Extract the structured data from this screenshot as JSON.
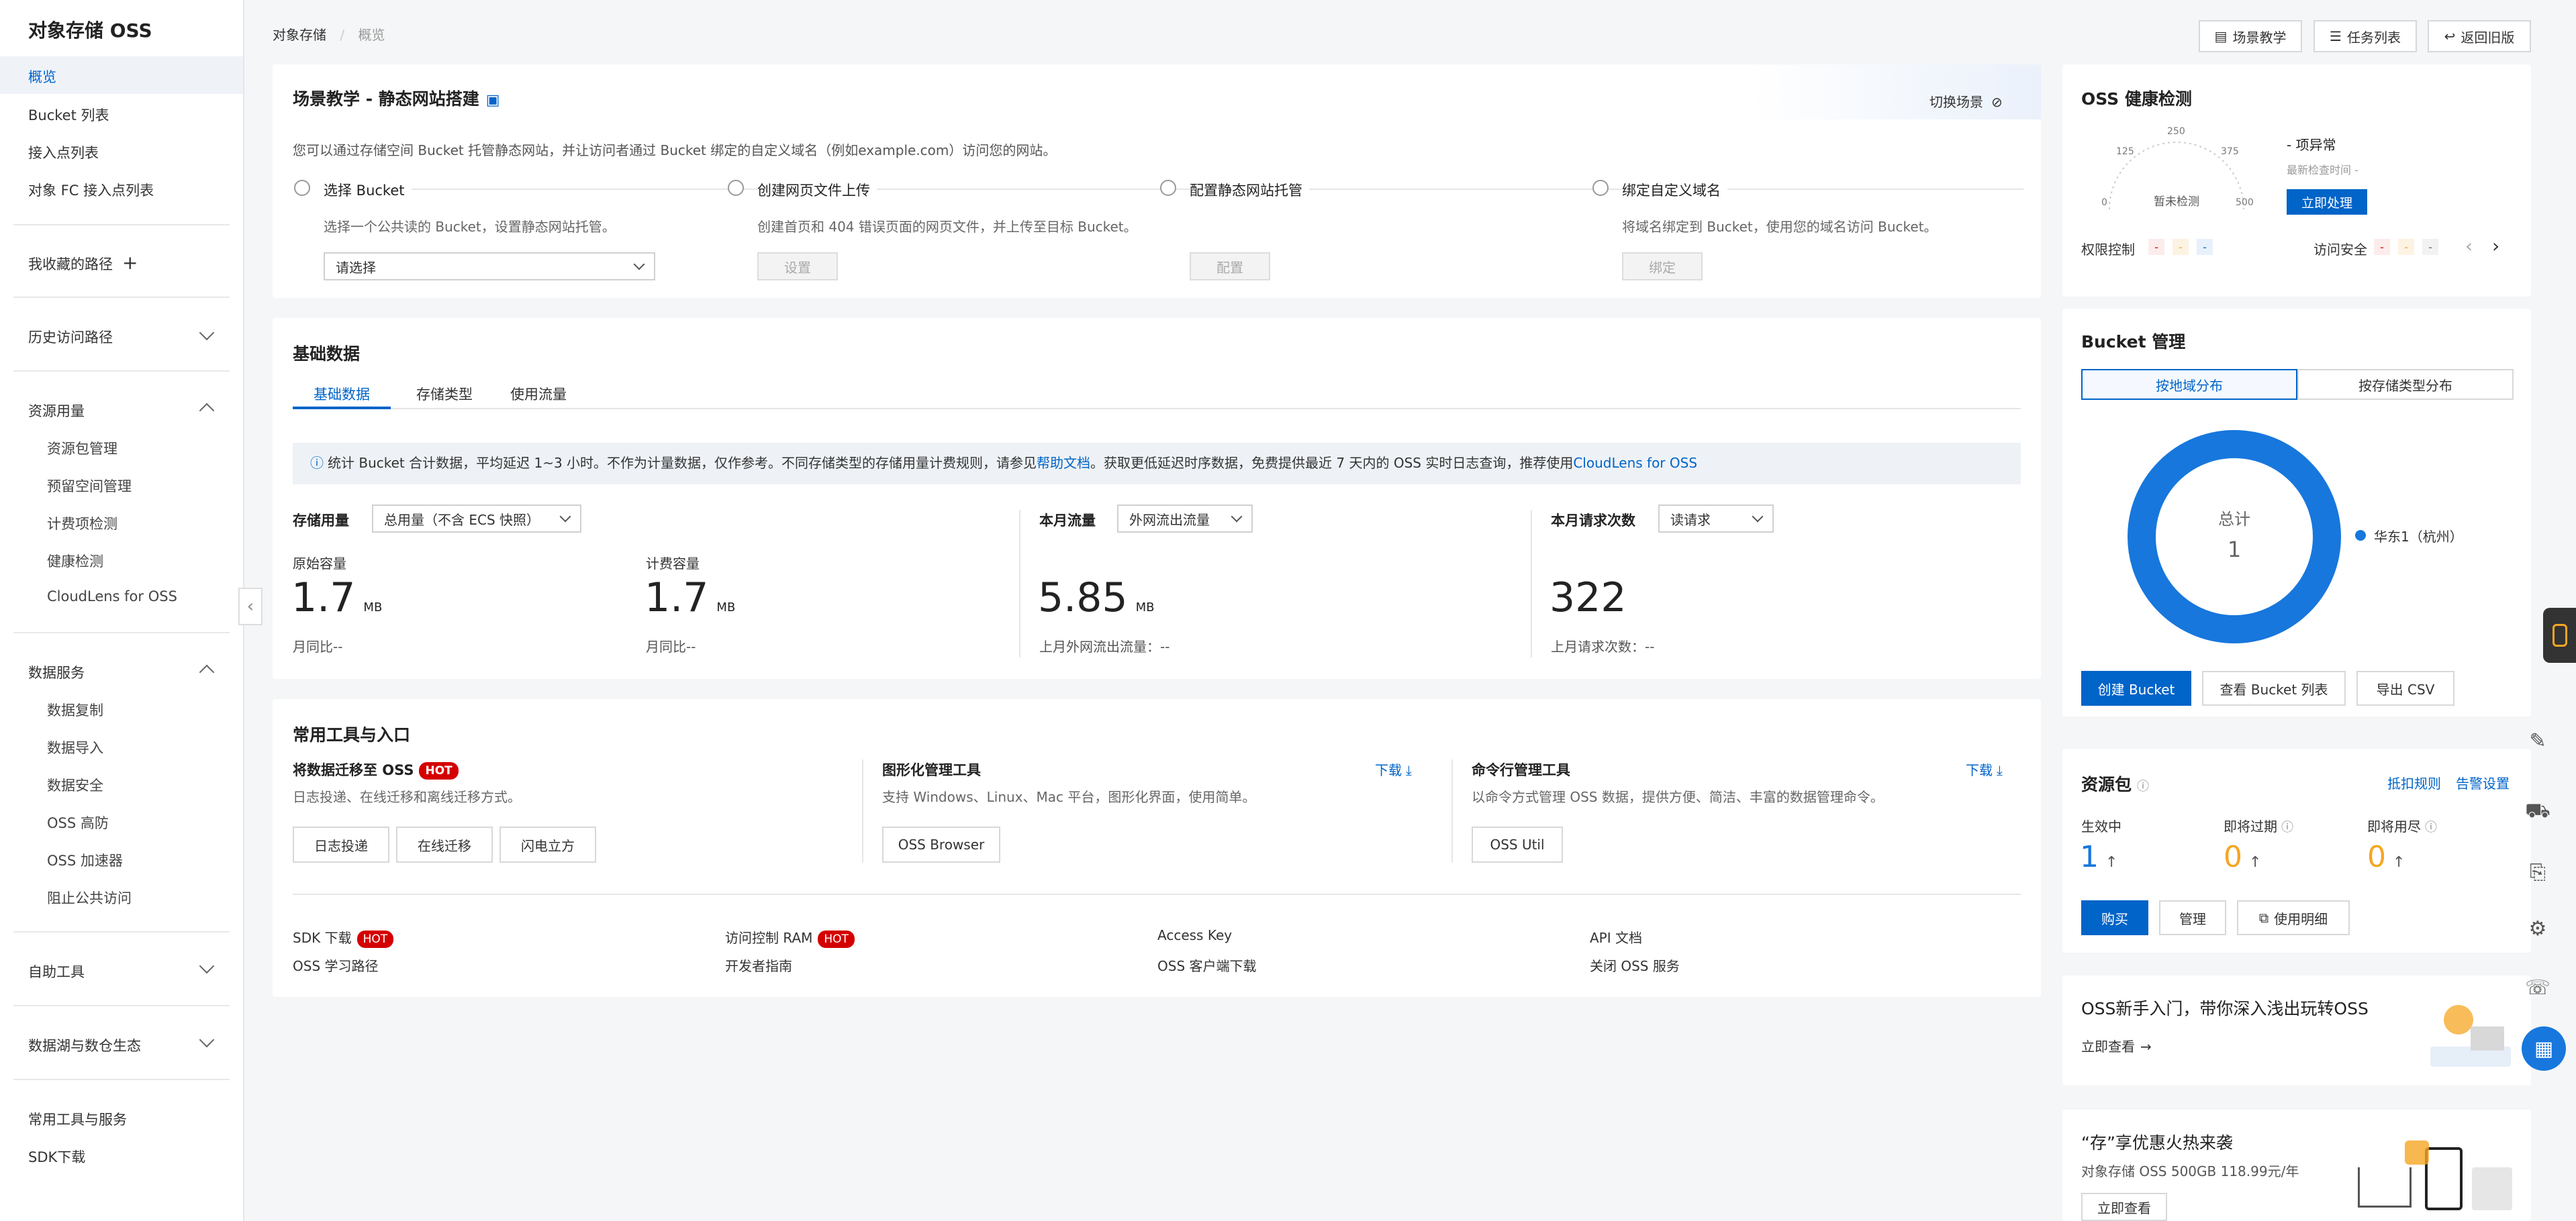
{
  "sidebar": {
    "title": "对象存储 OSS",
    "items": [
      "概览",
      "Bucket 列表",
      "接入点列表",
      "对象 FC 接入点列表"
    ],
    "favorites": "我收藏的路径",
    "history": "历史访问路径",
    "resource_usage": "资源用量",
    "resource_items": [
      "资源包管理",
      "预留空间管理",
      "计费项检测",
      "健康检测",
      "CloudLens for OSS"
    ],
    "data_services": "数据服务",
    "data_items": [
      "数据复制",
      "数据导入",
      "数据安全",
      "OSS 高防",
      "OSS 加速器",
      "阻止公共访问"
    ],
    "self_tools": "自助工具",
    "data_lake": "数据湖与数仓生态",
    "common_tools": "常用工具与服务",
    "sdk": "SDK下载"
  },
  "breadcrumb": {
    "root": "对象存储",
    "sep": "/",
    "current": "概览"
  },
  "top_buttons": {
    "scene": "场景教学",
    "tasks": "任务列表",
    "back": "返回旧版"
  },
  "scene": {
    "title": "场景教学 - 静态网站搭建",
    "switch": "切换场景",
    "desc": "您可以通过存储空间 Bucket 托管静态网站，并让访问者通过 Bucket 绑定的自定义域名（例如example.com）访问您的网站。",
    "steps": [
      {
        "title": "选择 Bucket",
        "desc": "选择一个公共读的 Bucket，设置静态网站托管。"
      },
      {
        "title": "创建网页文件上传",
        "desc": "创建首页和 404 错误页面的网页文件，并上传至目标 Bucket。",
        "button": "设置"
      },
      {
        "title": "配置静态网站托管",
        "desc": "",
        "button": "配置"
      },
      {
        "title": "绑定自定义域名",
        "desc": "将域名绑定到 Bucket，使用您的域名访问 Bucket。",
        "button": "绑定"
      }
    ],
    "select_placeholder": "请选择"
  },
  "basic": {
    "title": "基础数据",
    "tabs": [
      "基础数据",
      "存储类型",
      "使用流量"
    ],
    "notice_pre": "统计 Bucket 合计数据，平均延迟 1~3 小时。不作为计量数据，仅作参考。不同存储类型的存储用量计费规则，请参见",
    "notice_link1": "帮助文档",
    "notice_mid": "。获取更低延迟时序数据，免费提供最近 7 天内的 OSS 实时日志查询，推荐使用",
    "notice_link2": "CloudLens for OSS",
    "storage_label": "存储用量",
    "storage_select": "总用量（不含 ECS 快照）",
    "raw_label": "原始容量",
    "raw_value": "1.7",
    "raw_unit": "MB",
    "raw_mom": "月同比--",
    "bill_label": "计费容量",
    "bill_value": "1.7",
    "bill_unit": "MB",
    "bill_mom": "月同比--",
    "traffic_label": "本月流量",
    "traffic_select": "外网流出流量",
    "traffic_value": "5.85",
    "traffic_unit": "MB",
    "traffic_last": "上月外网流出流量：--",
    "req_label": "本月请求次数",
    "req_select": "读请求",
    "req_value": "322",
    "req_last": "上月请求次数：--"
  },
  "tools": {
    "title": "常用工具与入口",
    "migrate_title": "将数据迁移至 OSS",
    "hot": "HOT",
    "migrate_desc": "日志投递、在线迁移和离线迁移方式。",
    "migrate_buttons": [
      "日志投递",
      "在线迁移",
      "闪电立方"
    ],
    "gui_title": "图形化管理工具",
    "gui_download": "下载",
    "gui_desc": "支持 Windows、Linux、Mac 平台，图形化界面，使用简单。",
    "gui_button": "OSS Browser",
    "cli_title": "命令行管理工具",
    "cli_download": "下载",
    "cli_desc": "以命令方式管理 OSS 数据，提供方便、简洁、丰富的数据管理命令。",
    "cli_button": "OSS Util",
    "links": [
      "SDK 下载",
      "访问控制 RAM",
      "Access Key",
      "API 文档",
      "OSS 学习路径",
      "开发者指南",
      "OSS 客户端下载",
      "关闭 OSS 服务"
    ]
  },
  "health": {
    "title": "OSS 健康检测",
    "gauge_ticks": [
      "0",
      "125",
      "250",
      "375",
      "500"
    ],
    "gauge_center": "暂未检测",
    "abnormal": "- 项异常",
    "last_check": "最新检查时间 -",
    "fix_button": "立即处理",
    "perm": "权限控制",
    "access": "访问安全",
    "tag": "-"
  },
  "bucket": {
    "title": "Bucket 管理",
    "tab_region": "按地域分布",
    "tab_type": "按存储类型分布",
    "total_label": "总计",
    "total_value": "1",
    "legend": "华东1（杭州）",
    "create": "创建 Bucket",
    "view_list": "查看 Bucket 列表",
    "export": "导出 CSV"
  },
  "resource": {
    "title": "资源包",
    "deduct": "抵扣规则",
    "alarm": "告警设置",
    "active_label": "生效中",
    "active_value": "1",
    "expiring_label": "即将过期",
    "expiring_value": "0",
    "used_label": "即将用尽",
    "used_value": "0",
    "buy": "购买",
    "manage": "管理",
    "detail": "使用明细"
  },
  "promo1": {
    "title": "OSS新手入门，带你深入浅出玩转OSS",
    "link": "立即查看"
  },
  "promo2": {
    "title": "“存”享优惠火热来袭",
    "desc": "对象存储 OSS 500GB 118.99元/年",
    "button": "立即查看"
  },
  "colors": {
    "accent": "#0064c8",
    "ring": "#1777dd",
    "hot": "#d40000",
    "gold": "#f5a623"
  }
}
